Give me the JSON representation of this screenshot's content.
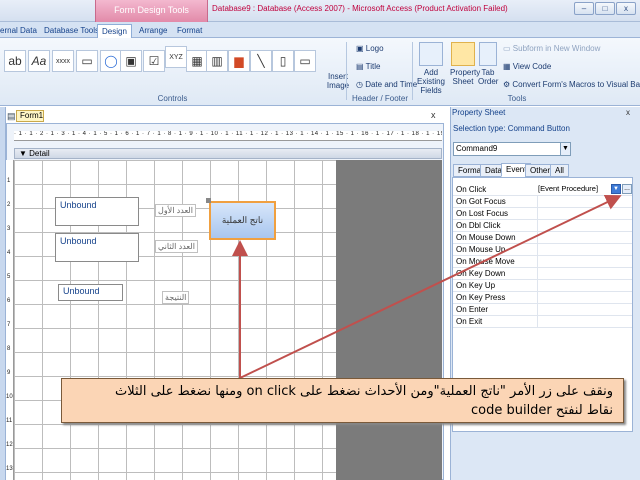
{
  "window": {
    "context_tab": "Form Design Tools",
    "title": "Database9 : Database (Access 2007) - Microsoft Access (Product Activation Failed)",
    "min_label": "–",
    "max_label": "□",
    "close_label": "x"
  },
  "ribbon_tabs": [
    "ernal Data",
    "Database Tools",
    "Design",
    "Arrange",
    "Format"
  ],
  "active_tab": "Design",
  "ribbon": {
    "controls_label": "Controls",
    "header_footer_label": "Header / Footer",
    "tools_label": "Tools",
    "insert_image": "Insert Image",
    "logo": "Logo",
    "title": "Title",
    "date_time": "Date and Time",
    "add_existing_fields": "Add Existing Fields",
    "property_sheet": "Property Sheet",
    "tab_order": "Tab Order",
    "subform_new_window": "Subform in New Window",
    "view_code": "View Code",
    "convert_macros": "Convert Form's Macros to Visual Basic",
    "tool_glyphs": [
      "ab",
      "Aa",
      "xxxx",
      "▭",
      "◯",
      "▣",
      "☑",
      "≡",
      "XYZ",
      "▦",
      "▥",
      "▤",
      "▆",
      "╲",
      "▯",
      "▭"
    ]
  },
  "form": {
    "tab_label": "Form1",
    "close_label": "x",
    "detail_label": "Detail",
    "ruler_marks": "· 1 · 1 · 2 · 1 · 3 · 1 · 4 · 1 · 5 · 1 · 6 · 1 · 7 · 1 · 8 · 1 · 9 · 1 · 10 · 1 · 11 · 1 · 12 · 1 · 13 · 1 · 14 · 1 · 15 · 1 · 16 · 1 · 17 · 1 · 18 · 1 · 19 · 1 · 20",
    "vruler_marks": [
      "1",
      "2",
      "3",
      "4",
      "5",
      "6",
      "7",
      "8",
      "9",
      "10",
      "11",
      "12",
      "13"
    ],
    "textboxes": [
      "Unbound",
      "Unbound",
      "Unbound"
    ],
    "labels": [
      "العدد الأول",
      "العدد الثاني",
      "النتيجة"
    ],
    "command_button": "ناتج العملية"
  },
  "property_sheet": {
    "title": "Property Sheet",
    "selection_type": "Selection type:  Command Button",
    "selected_control": "Command9",
    "tabs": [
      "Format",
      "Data",
      "Event",
      "Other",
      "All"
    ],
    "active_tab": "Event",
    "events": [
      "On Click",
      "On Got Focus",
      "On Lost Focus",
      "On Dbl Click",
      "On Mouse Down",
      "On Mouse Up",
      "On Mouse Move",
      "On Key Down",
      "On Key Up",
      "On Key Press",
      "On Enter",
      "On Exit"
    ],
    "on_click_value": "[Event Procedure]",
    "build_label": "..."
  },
  "callout": {
    "line1": "ونقف على زر الأمر \"ناتج العملية\"ومن الأحداث نضغط على on click ومنها نضغط على الثلاث",
    "line2": "نقاط لنفتح code builder"
  },
  "colors": {
    "accent": "#15428b",
    "context": "#e28aa9",
    "callout": "#fbd5b5",
    "arrow": "#c0504d"
  }
}
